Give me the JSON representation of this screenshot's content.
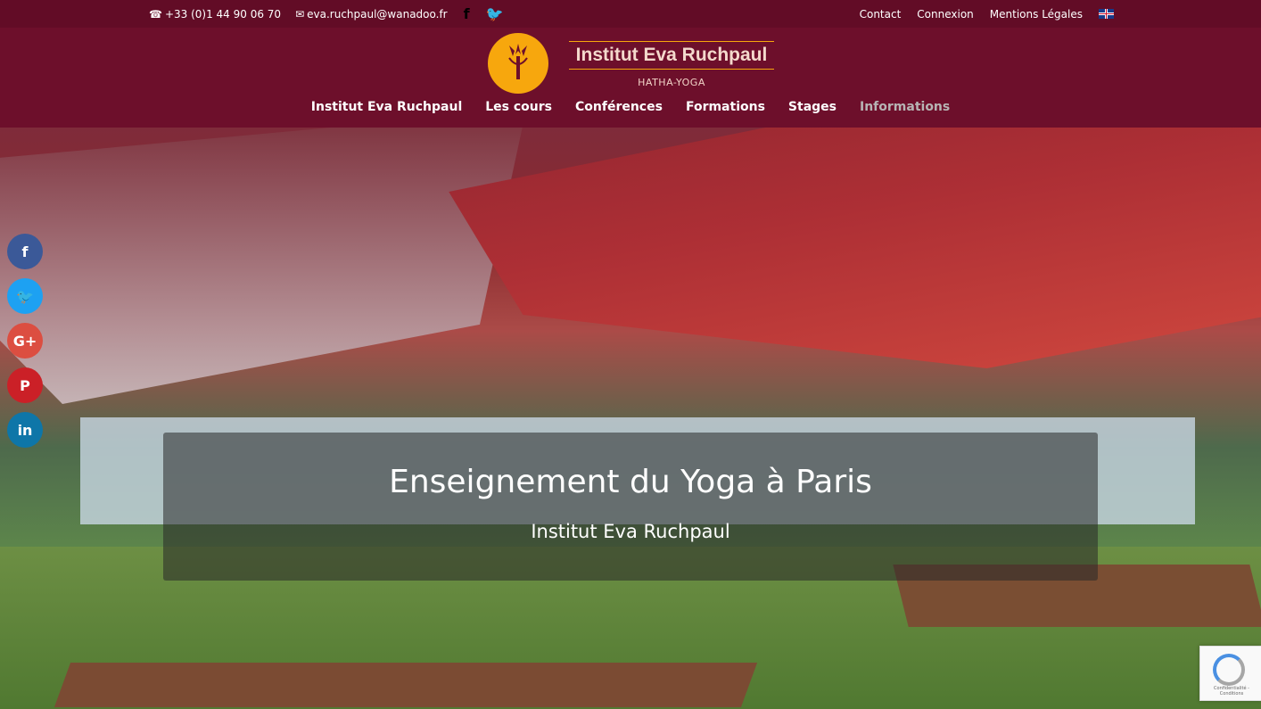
{
  "topbar": {
    "phone": "+33 (0)1 44 90 06 70",
    "email": "eva.ruchpaul@wanadoo.fr",
    "links": [
      "Contact",
      "Connexion",
      "Mentions Légales"
    ]
  },
  "logo": {
    "title": "Institut Eva Ruchpaul",
    "subtitle": "HATHA-YOGA"
  },
  "nav": {
    "items": [
      "Institut Eva Ruchpaul",
      "Les cours",
      "Conférences",
      "Formations",
      "Stages",
      "Informations"
    ]
  },
  "hero": {
    "heading": "Enseignement du Yoga à Paris",
    "subheading": "Institut Eva Ruchpaul"
  },
  "share": {
    "buttons": [
      "facebook-icon",
      "twitter-icon",
      "google-plus-icon",
      "pinterest-icon",
      "linkedin-icon"
    ]
  },
  "recaptcha": {
    "text": "Confidentialité - Conditions"
  },
  "colors": {
    "topbar": "#620c26",
    "header": "#6d0f2b",
    "accent": "#f7a70d",
    "facebook": "#3b5998",
    "twitter": "#1da1f2",
    "google": "#dc4e41",
    "pinterest": "#cb2027",
    "linkedin": "#0e76a8"
  }
}
